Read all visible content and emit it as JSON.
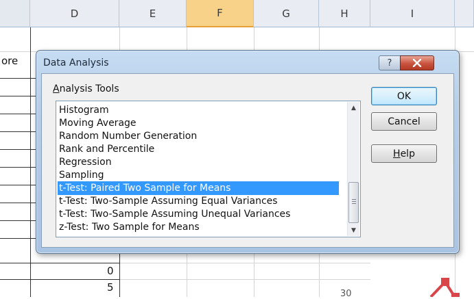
{
  "spreadsheet": {
    "columns": [
      {
        "letter": "D",
        "selected": false
      },
      {
        "letter": "E",
        "selected": false
      },
      {
        "letter": "F",
        "selected": true
      },
      {
        "letter": "G",
        "selected": false
      },
      {
        "letter": "H",
        "selected": false
      },
      {
        "letter": "I",
        "selected": false
      }
    ],
    "left_cell_fragment": "ore",
    "visible_values": [
      "0",
      "5"
    ],
    "chart_fragment": "30"
  },
  "dialog": {
    "title": "Data Analysis",
    "help_glyph": "?",
    "close_glyph": "✕",
    "section_label_first": "A",
    "section_label_rest": "nalysis Tools",
    "items": [
      "Histogram",
      "Moving Average",
      "Random Number Generation",
      "Rank and Percentile",
      "Regression",
      "Sampling",
      "t-Test: Paired Two Sample for Means",
      "t-Test: Two-Sample Assuming Equal Variances",
      "t-Test: Two-Sample Assuming Unequal Variances",
      "z-Test: Two Sample for Means"
    ],
    "selected_item": "t-Test: Paired Two Sample for Means",
    "buttons": {
      "ok": "OK",
      "cancel": "Cancel",
      "help_first": "H",
      "help_rest": "elp"
    }
  },
  "colors": {
    "selection": "#3399ff",
    "chart_line": "#d9464a"
  }
}
